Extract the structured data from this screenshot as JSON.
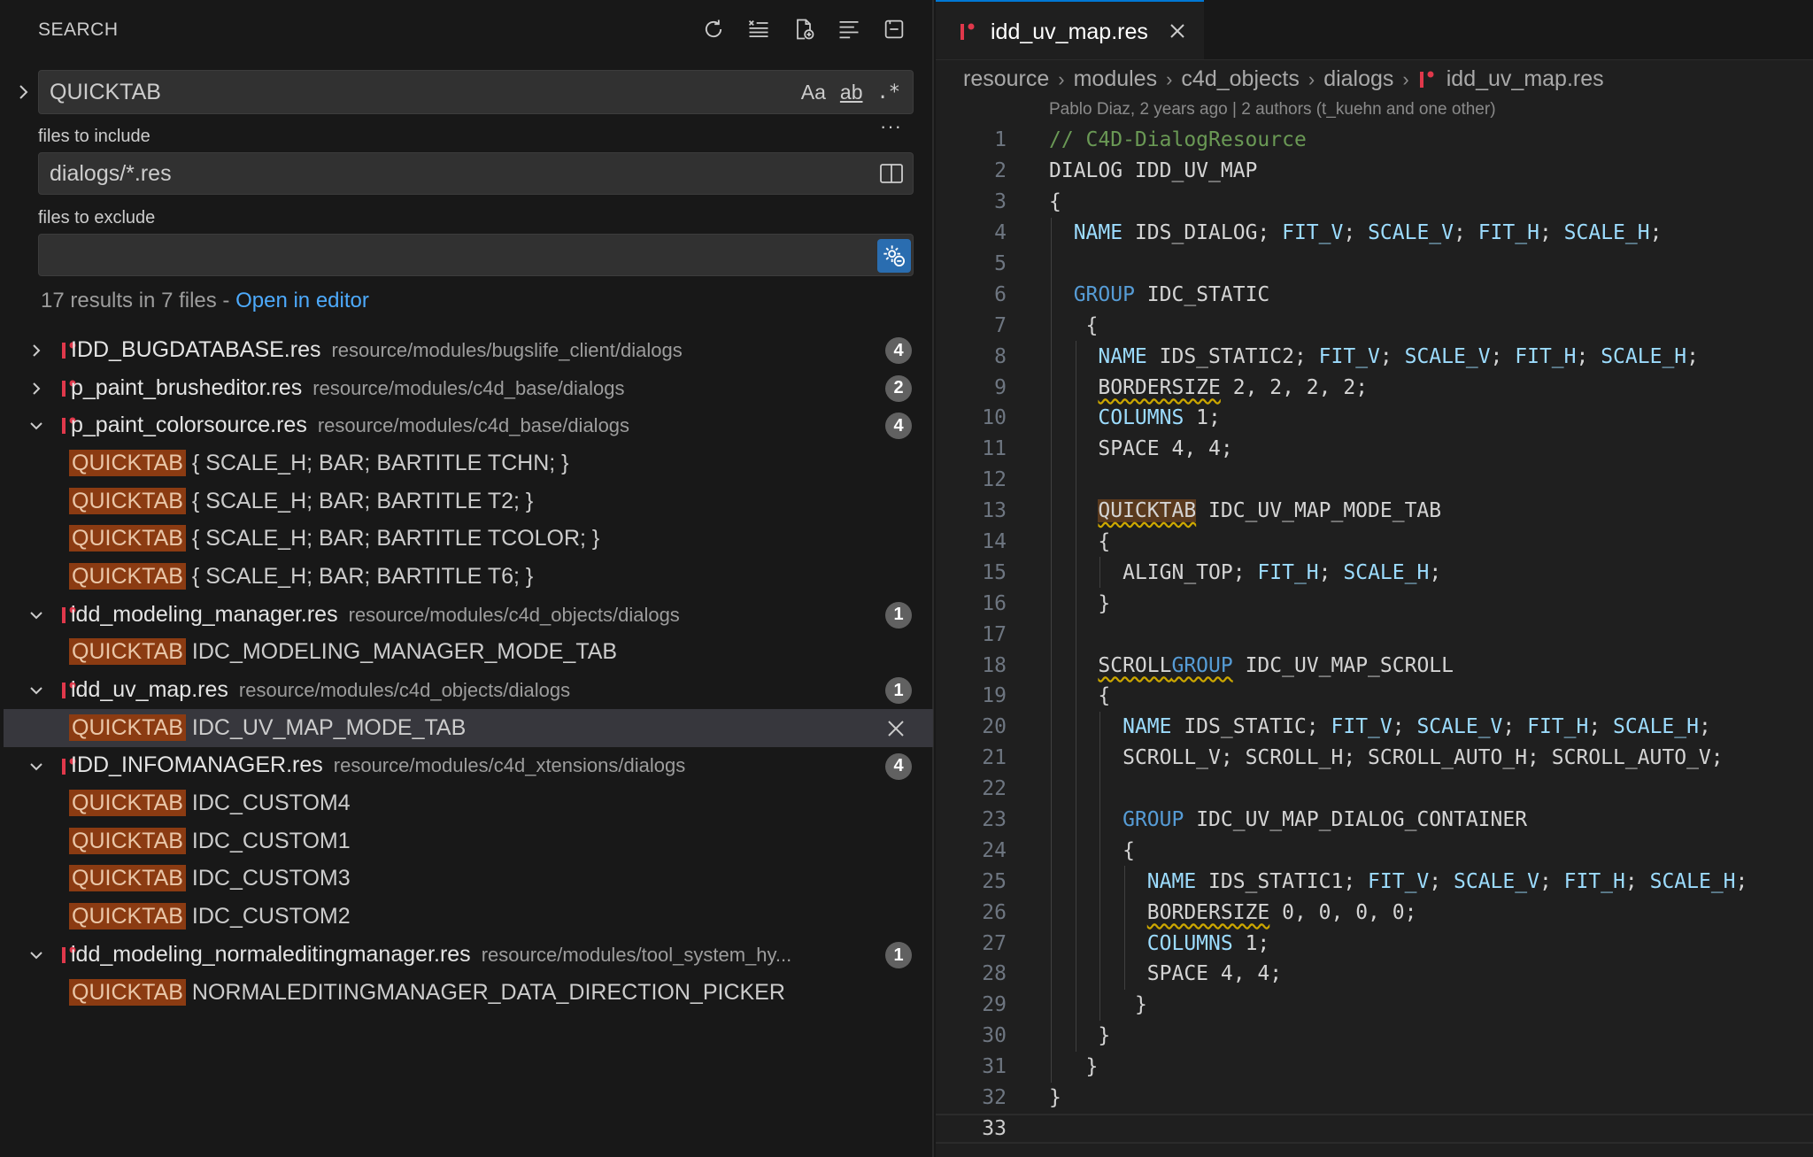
{
  "search_panel": {
    "title": "SEARCH",
    "query": "QUICKTAB",
    "opts": {
      "case": "Aa",
      "word": "ab",
      "regex": ".*"
    },
    "include_label": "files to include",
    "include_value": "dialogs/*.res",
    "exclude_label": "files to exclude",
    "exclude_value": "",
    "summary_text": "17 results in 7 files - ",
    "open_in_editor": "Open in editor",
    "more": "···"
  },
  "results": [
    {
      "file": "IDD_BUGDATABASE.res",
      "path": "resource/modules/bugslife_client/dialogs",
      "count": "4",
      "expanded": false,
      "matches": []
    },
    {
      "file": "p_paint_brusheditor.res",
      "path": "resource/modules/c4d_base/dialogs",
      "count": "2",
      "expanded": false,
      "matches": []
    },
    {
      "file": "p_paint_colorsource.res",
      "path": "resource/modules/c4d_base/dialogs",
      "count": "4",
      "expanded": true,
      "matches": [
        " { SCALE_H; BAR; BARTITLE TCHN; }",
        " { SCALE_H; BAR; BARTITLE T2; }",
        " { SCALE_H; BAR; BARTITLE TCOLOR; }",
        " { SCALE_H; BAR; BARTITLE T6; }"
      ]
    },
    {
      "file": "idd_modeling_manager.res",
      "path": "resource/modules/c4d_objects/dialogs",
      "count": "1",
      "expanded": true,
      "matches": [
        " IDC_MODELING_MANAGER_MODE_TAB"
      ]
    },
    {
      "file": "idd_uv_map.res",
      "path": "resource/modules/c4d_objects/dialogs",
      "count": "1",
      "expanded": true,
      "matches": [
        " IDC_UV_MAP_MODE_TAB"
      ]
    },
    {
      "file": "IDD_INFOMANAGER.res",
      "path": "resource/modules/c4d_xtensions/dialogs",
      "count": "4",
      "expanded": true,
      "matches": [
        " IDC_CUSTOM4",
        " IDC_CUSTOM1",
        " IDC_CUSTOM3",
        " IDC_CUSTOM2"
      ]
    },
    {
      "file": "idd_modeling_normaleditingmanager.res",
      "path": "resource/modules/tool_system_hy...",
      "count": "1",
      "expanded": true,
      "matches": [
        " NORMALEDITINGMANAGER_DATA_DIRECTION_PICKER"
      ]
    }
  ],
  "match_term": "QUICKTAB",
  "editor": {
    "tab_title": "idd_uv_map.res",
    "breadcrumbs": [
      "resource",
      "modules",
      "c4d_objects",
      "dialogs",
      "idd_uv_map.res"
    ],
    "blame": "Pablo Diaz, 2 years ago | 2 authors (t_kuehn and one other)",
    "active_line": "33",
    "lines": [
      {
        "n": "1",
        "indent": 0,
        "tokens": [
          [
            "cm",
            "// C4D-DialogResource"
          ]
        ]
      },
      {
        "n": "2",
        "indent": 0,
        "tokens": [
          [
            "id",
            "DIALOG IDD_UV_MAP"
          ]
        ]
      },
      {
        "n": "3",
        "indent": 0,
        "tokens": [
          [
            "id",
            "{"
          ]
        ]
      },
      {
        "n": "4",
        "indent": 1,
        "tokens": [
          [
            "cn",
            "NAME"
          ],
          [
            "id",
            " IDS_DIALOG; "
          ],
          [
            "cn",
            "FIT_V"
          ],
          [
            "id",
            "; "
          ],
          [
            "cn",
            "SCALE_V"
          ],
          [
            "id",
            "; "
          ],
          [
            "cn",
            "FIT_H"
          ],
          [
            "id",
            "; "
          ],
          [
            "cn",
            "SCALE_H"
          ],
          [
            "id",
            ";"
          ]
        ]
      },
      {
        "n": "5",
        "indent": 1,
        "tokens": []
      },
      {
        "n": "6",
        "indent": 1,
        "tokens": [
          [
            "kw",
            "GROUP"
          ],
          [
            "id",
            " IDC_STATIC"
          ]
        ]
      },
      {
        "n": "7",
        "indent": 1,
        "tokens": [
          [
            "id",
            " {"
          ]
        ]
      },
      {
        "n": "8",
        "indent": 2,
        "tokens": [
          [
            "cn",
            "NAME"
          ],
          [
            "id",
            " IDS_STATIC2; "
          ],
          [
            "cn",
            "FIT_V"
          ],
          [
            "id",
            "; "
          ],
          [
            "cn",
            "SCALE_V"
          ],
          [
            "id",
            "; "
          ],
          [
            "cn",
            "FIT_H"
          ],
          [
            "id",
            "; "
          ],
          [
            "cn",
            "SCALE_H"
          ],
          [
            "id",
            ";"
          ]
        ]
      },
      {
        "n": "9",
        "indent": 2,
        "tokens": [
          [
            "sq",
            "BORDERSIZE"
          ],
          [
            "id",
            " 2, 2, 2, 2;"
          ]
        ]
      },
      {
        "n": "10",
        "indent": 2,
        "tokens": [
          [
            "cn",
            "COLUMNS"
          ],
          [
            "id",
            " 1;"
          ]
        ]
      },
      {
        "n": "11",
        "indent": 2,
        "tokens": [
          [
            "id",
            "SPACE 4, 4;"
          ]
        ]
      },
      {
        "n": "12",
        "indent": 2,
        "tokens": []
      },
      {
        "n": "13",
        "indent": 2,
        "tokens": [
          [
            "qt",
            "QUICKTAB"
          ],
          [
            "id",
            " IDC_UV_MAP_MODE_TAB"
          ]
        ]
      },
      {
        "n": "14",
        "indent": 2,
        "tokens": [
          [
            "id",
            "{"
          ]
        ]
      },
      {
        "n": "15",
        "indent": 3,
        "tokens": [
          [
            "id",
            "ALIGN_TOP; "
          ],
          [
            "cn",
            "FIT_H"
          ],
          [
            "id",
            "; "
          ],
          [
            "cn",
            "SCALE_H"
          ],
          [
            "id",
            ";"
          ]
        ]
      },
      {
        "n": "16",
        "indent": 2,
        "tokens": [
          [
            "id",
            "}"
          ]
        ]
      },
      {
        "n": "17",
        "indent": 2,
        "tokens": []
      },
      {
        "n": "18",
        "indent": 2,
        "tokens": [
          [
            "sq",
            "SCROLL"
          ],
          [
            "sqk",
            "GROUP"
          ],
          [
            "id",
            " IDC_UV_MAP_SCROLL"
          ]
        ]
      },
      {
        "n": "19",
        "indent": 2,
        "tokens": [
          [
            "id",
            "{"
          ]
        ]
      },
      {
        "n": "20",
        "indent": 3,
        "tokens": [
          [
            "cn",
            "NAME"
          ],
          [
            "id",
            " IDS_STATIC; "
          ],
          [
            "cn",
            "FIT_V"
          ],
          [
            "id",
            "; "
          ],
          [
            "cn",
            "SCALE_V"
          ],
          [
            "id",
            "; "
          ],
          [
            "cn",
            "FIT_H"
          ],
          [
            "id",
            "; "
          ],
          [
            "cn",
            "SCALE_H"
          ],
          [
            "id",
            ";"
          ]
        ]
      },
      {
        "n": "21",
        "indent": 3,
        "tokens": [
          [
            "id",
            "SCROLL_V; SCROLL_H; SCROLL_AUTO_H; SCROLL_AUTO_V;"
          ]
        ]
      },
      {
        "n": "22",
        "indent": 3,
        "tokens": []
      },
      {
        "n": "23",
        "indent": 3,
        "tokens": [
          [
            "kw",
            "GROUP"
          ],
          [
            "id",
            " IDC_UV_MAP_DIALOG_CONTAINER"
          ]
        ]
      },
      {
        "n": "24",
        "indent": 3,
        "tokens": [
          [
            "id",
            "{"
          ]
        ]
      },
      {
        "n": "25",
        "indent": 4,
        "tokens": [
          [
            "cn",
            "NAME"
          ],
          [
            "id",
            " IDS_STATIC1; "
          ],
          [
            "cn",
            "FIT_V"
          ],
          [
            "id",
            "; "
          ],
          [
            "cn",
            "SCALE_V"
          ],
          [
            "id",
            "; "
          ],
          [
            "cn",
            "FIT_H"
          ],
          [
            "id",
            "; "
          ],
          [
            "cn",
            "SCALE_H"
          ],
          [
            "id",
            ";"
          ]
        ]
      },
      {
        "n": "26",
        "indent": 4,
        "tokens": [
          [
            "sq",
            "BORDERSIZE"
          ],
          [
            "id",
            " 0, 0, 0, 0;"
          ]
        ]
      },
      {
        "n": "27",
        "indent": 4,
        "tokens": [
          [
            "cn",
            "COLUMNS"
          ],
          [
            "id",
            " 1;"
          ]
        ]
      },
      {
        "n": "28",
        "indent": 4,
        "tokens": [
          [
            "id",
            "SPACE 4, 4;"
          ]
        ]
      },
      {
        "n": "29",
        "indent": 3,
        "tokens": [
          [
            "id",
            " }"
          ]
        ]
      },
      {
        "n": "30",
        "indent": 2,
        "tokens": [
          [
            "id",
            "}"
          ]
        ]
      },
      {
        "n": "31",
        "indent": 1,
        "tokens": [
          [
            "id",
            " }"
          ]
        ]
      },
      {
        "n": "32",
        "indent": 0,
        "tokens": [
          [
            "id",
            "}"
          ]
        ]
      },
      {
        "n": "33",
        "indent": 0,
        "tokens": []
      }
    ]
  },
  "colors": {
    "accent": "#0078d4",
    "link": "#4daafc",
    "match_bg": "#8b3b12",
    "badge": "#616161",
    "file_icon": "#e0384b"
  }
}
